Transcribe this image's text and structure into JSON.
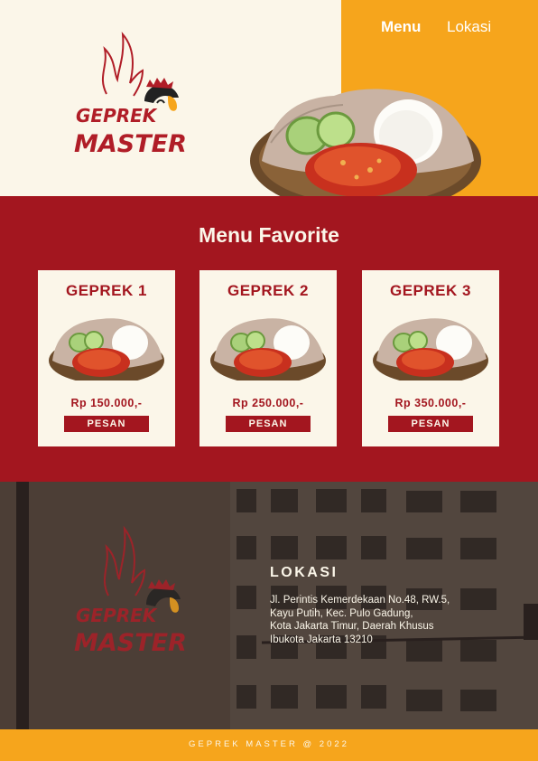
{
  "nav": {
    "menu": "Menu",
    "lokasi": "Lokasi"
  },
  "brand": {
    "line1": "GEPREK",
    "line2": "MASTER"
  },
  "menu_section": {
    "title": "Menu Favorite",
    "items": [
      {
        "name": "GEPREK 1",
        "price": "Rp 150.000,-",
        "button": "PESAN"
      },
      {
        "name": "GEPREK 2",
        "price": "Rp 250.000,-",
        "button": "PESAN"
      },
      {
        "name": "GEPREK 3",
        "price": "Rp 350.000,-",
        "button": "PESAN"
      }
    ]
  },
  "location": {
    "title": "LOKASI",
    "address_lines": [
      "Jl. Perintis Kemerdekaan No.48, RW.5,",
      "Kayu Putih, Kec. Pulo Gadung,",
      "Kota Jakarta Timur, Daerah Khusus",
      "Ibukota Jakarta 13210"
    ]
  },
  "footer": {
    "text": "GEPREK MASTER @ 2022"
  },
  "colors": {
    "cream": "#fbf6e9",
    "orange": "#f6a51c",
    "red": "#a3161f"
  }
}
